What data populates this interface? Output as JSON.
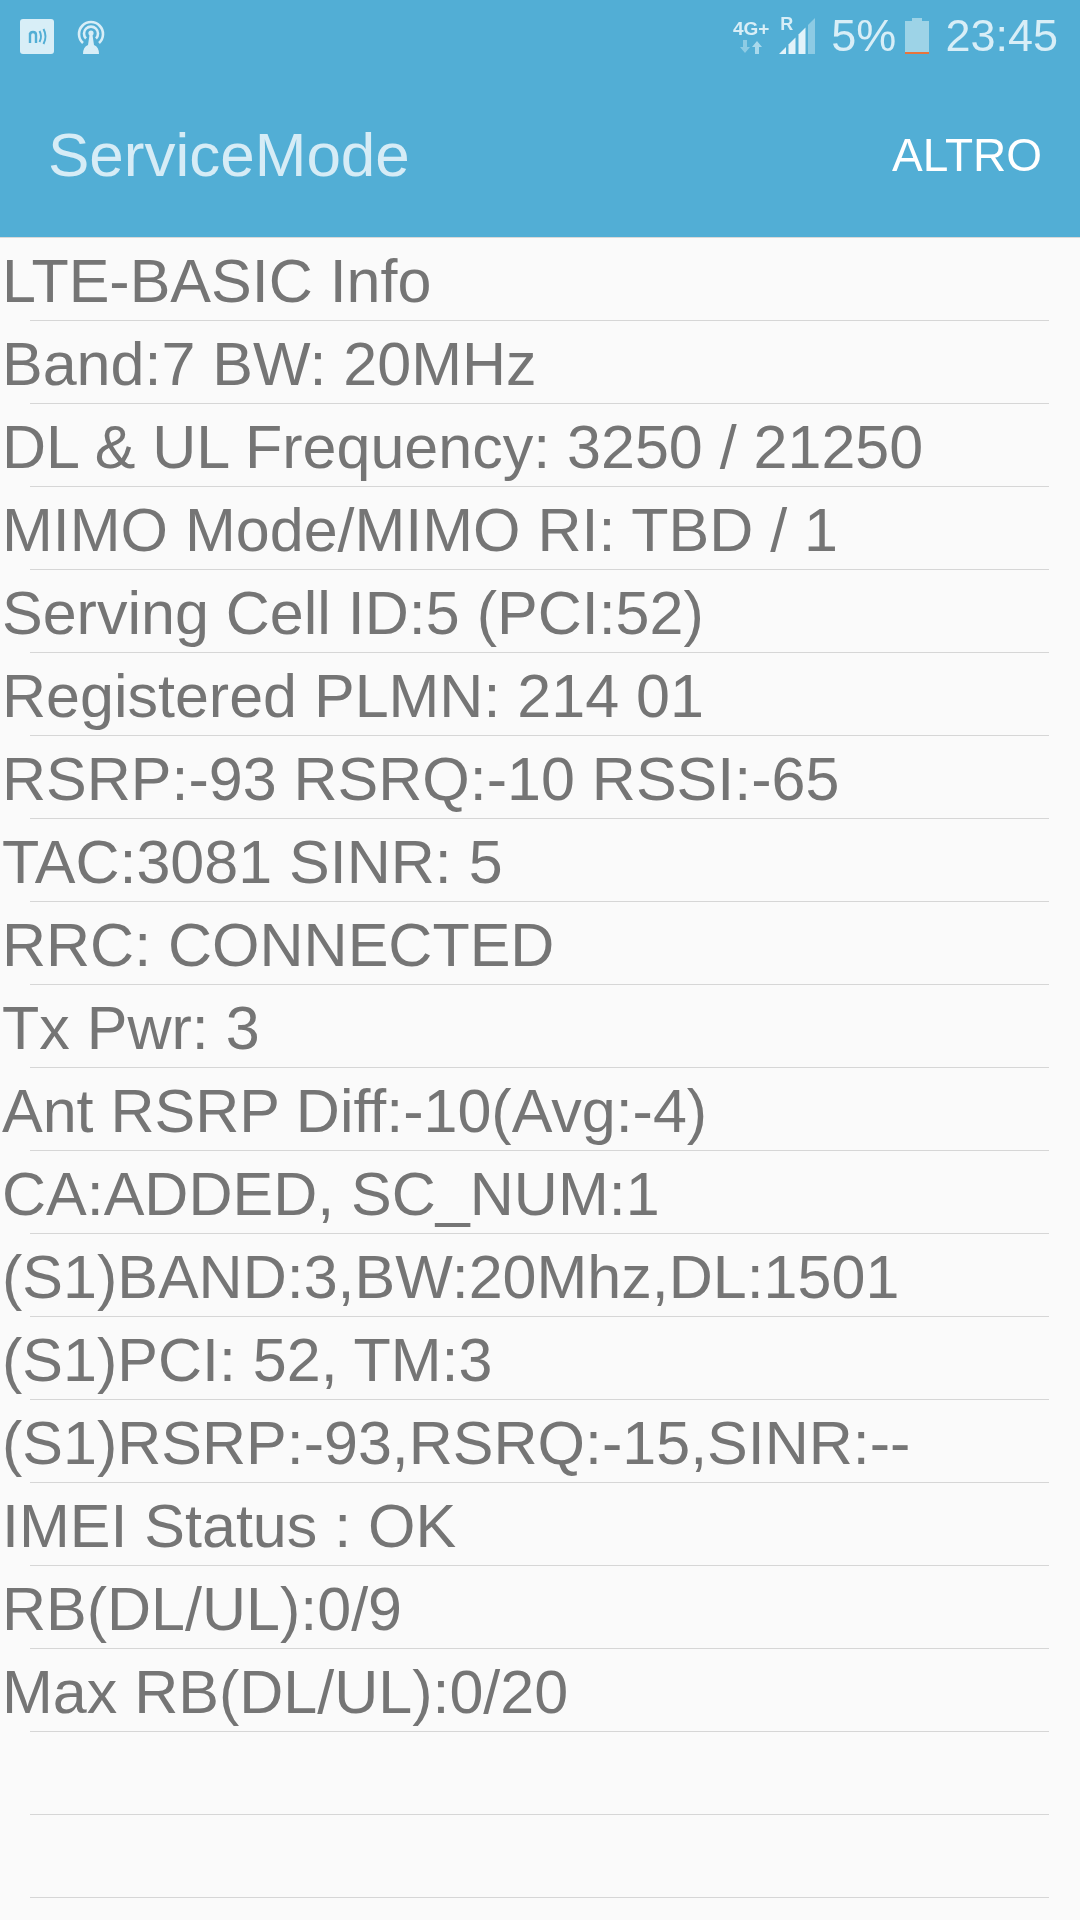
{
  "status_bar": {
    "network_type": "4G+",
    "roaming": "R",
    "battery": "5%",
    "time": "23:45"
  },
  "toolbar": {
    "title": "ServiceMode",
    "menu_button": "ALTRO"
  },
  "info_lines": [
    "LTE-BASIC Info",
    "Band:7 BW: 20MHz",
    "DL & UL Frequency: 3250 / 21250",
    "MIMO Mode/MIMO RI: TBD / 1",
    "Serving Cell ID:5 (PCI:52)",
    "Registered PLMN: 214 01",
    "RSRP:-93 RSRQ:-10 RSSI:-65",
    "TAC:3081 SINR: 5",
    "RRC: CONNECTED",
    "Tx Pwr: 3",
    "Ant RSRP Diff:-10(Avg:-4)",
    "CA:ADDED, SC_NUM:1",
    "(S1)BAND:3,BW:20Mhz,DL:1501",
    "(S1)PCI: 52, TM:3",
    "(S1)RSRP:-93,RSRQ:-15,SINR:--",
    "IMEI Status : OK",
    "RB(DL/UL):0/9",
    "Max RB(DL/UL):0/20"
  ]
}
